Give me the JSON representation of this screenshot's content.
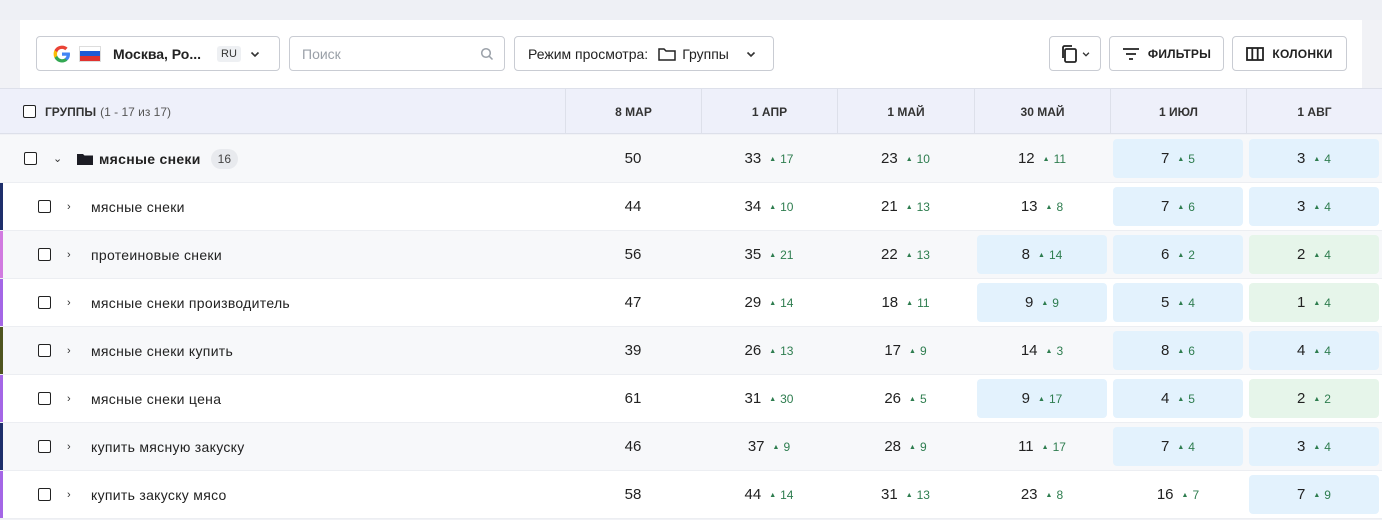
{
  "toolbar": {
    "location": "Москва, Ро...",
    "lang": "RU",
    "search_placeholder": "Поиск",
    "view_label": "Режим просмотра:",
    "view_value": "Группы",
    "filters_label": "ФИЛЬТРЫ",
    "columns_label": "КОЛОНКИ"
  },
  "table": {
    "groups_header": "ГРУППЫ",
    "groups_count": "(1 - 17 из 17)",
    "dates": [
      "8 МАР",
      "1 АПР",
      "1 МАЙ",
      "30 МАЙ",
      "1 ИЮЛ",
      "1 АВГ"
    ],
    "group_row": {
      "label": "мясные снеки",
      "count": "16",
      "values": [
        {
          "v": "50",
          "d": ""
        },
        {
          "v": "33",
          "d": "17"
        },
        {
          "v": "23",
          "d": "10"
        },
        {
          "v": "12",
          "d": "11"
        },
        {
          "v": "7",
          "d": "5",
          "hl": "blue"
        },
        {
          "v": "3",
          "d": "4",
          "hl": "blue"
        }
      ]
    },
    "rows": [
      {
        "label": "мясные снеки",
        "stripe": "#1e2f6b",
        "values": [
          {
            "v": "44",
            "d": ""
          },
          {
            "v": "34",
            "d": "10"
          },
          {
            "v": "21",
            "d": "13"
          },
          {
            "v": "13",
            "d": "8"
          },
          {
            "v": "7",
            "d": "6",
            "hl": "blue"
          },
          {
            "v": "3",
            "d": "4",
            "hl": "blue"
          }
        ]
      },
      {
        "label": "протеиновые снеки",
        "stripe": "#d17ae0",
        "values": [
          {
            "v": "56",
            "d": ""
          },
          {
            "v": "35",
            "d": "21"
          },
          {
            "v": "22",
            "d": "13"
          },
          {
            "v": "8",
            "d": "14",
            "hl": "blue"
          },
          {
            "v": "6",
            "d": "2",
            "hl": "blue"
          },
          {
            "v": "2",
            "d": "4",
            "hl": "green"
          }
        ]
      },
      {
        "label": "мясные снеки производитель",
        "stripe": "#a466e6",
        "values": [
          {
            "v": "47",
            "d": ""
          },
          {
            "v": "29",
            "d": "14"
          },
          {
            "v": "18",
            "d": "11"
          },
          {
            "v": "9",
            "d": "9",
            "hl": "blue"
          },
          {
            "v": "5",
            "d": "4",
            "hl": "blue"
          },
          {
            "v": "1",
            "d": "4",
            "hl": "green"
          }
        ]
      },
      {
        "label": "мясные снеки купить",
        "stripe": "#4f5520",
        "values": [
          {
            "v": "39",
            "d": ""
          },
          {
            "v": "26",
            "d": "13"
          },
          {
            "v": "17",
            "d": "9"
          },
          {
            "v": "14",
            "d": "3"
          },
          {
            "v": "8",
            "d": "6",
            "hl": "blue"
          },
          {
            "v": "4",
            "d": "4",
            "hl": "blue"
          }
        ]
      },
      {
        "label": "мясные снеки цена",
        "stripe": "#a466e6",
        "values": [
          {
            "v": "61",
            "d": ""
          },
          {
            "v": "31",
            "d": "30"
          },
          {
            "v": "26",
            "d": "5"
          },
          {
            "v": "9",
            "d": "17",
            "hl": "blue"
          },
          {
            "v": "4",
            "d": "5",
            "hl": "blue"
          },
          {
            "v": "2",
            "d": "2",
            "hl": "green"
          }
        ]
      },
      {
        "label": "купить мясную закуску",
        "stripe": "#1e2f6b",
        "values": [
          {
            "v": "46",
            "d": ""
          },
          {
            "v": "37",
            "d": "9"
          },
          {
            "v": "28",
            "d": "9"
          },
          {
            "v": "11",
            "d": "17"
          },
          {
            "v": "7",
            "d": "4",
            "hl": "blue"
          },
          {
            "v": "3",
            "d": "4",
            "hl": "blue"
          }
        ]
      },
      {
        "label": "купить закуску мясо",
        "stripe": "#a466e6",
        "values": [
          {
            "v": "58",
            "d": ""
          },
          {
            "v": "44",
            "d": "14"
          },
          {
            "v": "31",
            "d": "13"
          },
          {
            "v": "23",
            "d": "8"
          },
          {
            "v": "16",
            "d": "7"
          },
          {
            "v": "7",
            "d": "9",
            "hl": "blue"
          }
        ]
      }
    ]
  },
  "colors": {
    "highlight_blue": "#e3f2fd",
    "highlight_green": "#e6f5ea",
    "delta_green": "#2e7d4f"
  }
}
